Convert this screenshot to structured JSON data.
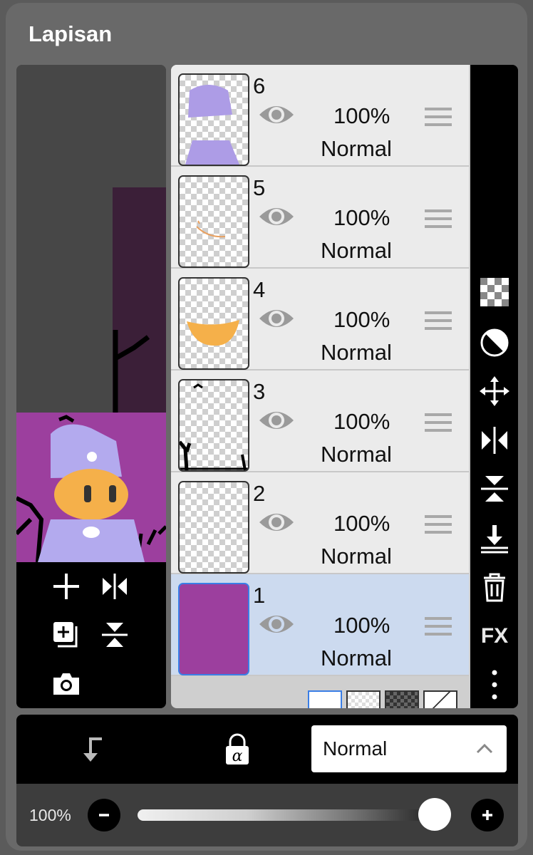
{
  "panel": {
    "title": "Lapisan"
  },
  "layers": [
    {
      "number": "6",
      "opacity": "100%",
      "mode": "Normal",
      "selected": false
    },
    {
      "number": "5",
      "opacity": "100%",
      "mode": "Normal",
      "selected": false
    },
    {
      "number": "4",
      "opacity": "100%",
      "mode": "Normal",
      "selected": false
    },
    {
      "number": "3",
      "opacity": "100%",
      "mode": "Normal",
      "selected": false
    },
    {
      "number": "2",
      "opacity": "100%",
      "mode": "Normal",
      "selected": false
    },
    {
      "number": "1",
      "opacity": "100%",
      "mode": "Normal",
      "selected": true
    }
  ],
  "preview_tools": [
    "add-layer-icon",
    "flip-horizontal-icon",
    "duplicate-layer-icon",
    "flip-vertical-icon",
    "camera-icon"
  ],
  "right_toolbar": {
    "tools": [
      "transparency-icon",
      "invert-icon",
      "move-icon",
      "flip-horizontal-icon",
      "flip-vertical-icon",
      "merge-down-icon",
      "trash-icon",
      "fx-icon",
      "more-icon"
    ],
    "fx_label": "FX"
  },
  "bottom_bar": {
    "blend_mode": "Normal",
    "icons": [
      "clip-arrow-icon",
      "alpha-lock-icon",
      "chevron-up-icon"
    ]
  },
  "opacity": {
    "label": "100%",
    "value": 1.0
  },
  "colors": {
    "panel": "#696969",
    "selected_layer": "#ccdaef",
    "layer_bg": "#ebebeb",
    "canvas_purple": "#9c3f9e",
    "accent_blue": "#3a7ee6"
  }
}
